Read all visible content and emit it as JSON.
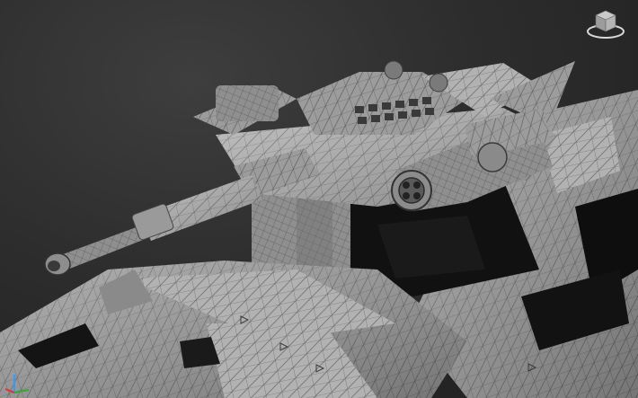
{
  "viewport": {
    "background_color": "#2d2d2d",
    "model_color": "#9a9a9a",
    "wire_color": "#4a4a4a",
    "shadow_color": "#0d0d0d"
  },
  "viewcube": {
    "icon": "viewcube-icon"
  },
  "axis_gizmo": {
    "icon": "axis-gizmo-icon",
    "colors": [
      "#d33",
      "#3a3",
      "#39f"
    ]
  }
}
